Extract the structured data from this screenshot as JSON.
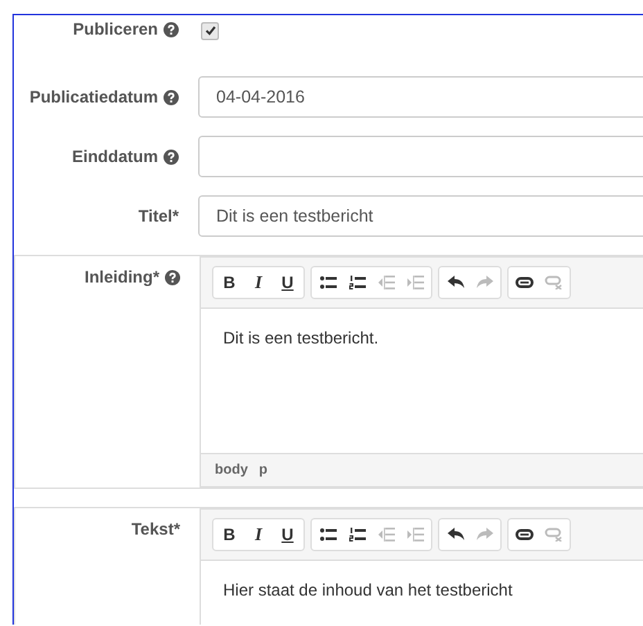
{
  "fields": [
    {
      "label": "Publiceren",
      "help": true,
      "kind": "checkbox",
      "checked": true
    },
    {
      "label": "Publicatiedatum",
      "help": true,
      "kind": "text",
      "value": "04-04-2016"
    },
    {
      "label": "Einddatum",
      "help": true,
      "kind": "text"
    },
    {
      "label": "Titel*",
      "help": false,
      "kind": "text",
      "value": "Dit is een testbericht"
    },
    {
      "label": "Inleiding*",
      "help": true,
      "kind": "editor",
      "content": "Dit is een testbericht.",
      "path": [
        "body",
        "p"
      ],
      "toolbar": [
        [
          {
            "kind": "bold",
            "label": "B",
            "disabled": false
          },
          {
            "kind": "italic",
            "label": "I",
            "disabled": false
          },
          {
            "kind": "underline",
            "label": "U",
            "disabled": false
          }
        ],
        [
          {
            "kind": "bullets",
            "disabled": false
          },
          {
            "kind": "numbers",
            "disabled": false
          },
          {
            "kind": "outdent",
            "disabled": true
          },
          {
            "kind": "indent",
            "disabled": true
          }
        ],
        [
          {
            "kind": "undo",
            "disabled": false
          },
          {
            "kind": "redo",
            "disabled": true
          }
        ],
        [
          {
            "kind": "link",
            "disabled": false
          },
          {
            "kind": "unlink",
            "disabled": true
          }
        ]
      ]
    },
    {
      "label": "Tekst*",
      "help": false,
      "kind": "editor",
      "content": "Hier staat de inhoud van het testbericht",
      "toolbar": [
        [
          {
            "kind": "bold",
            "label": "B",
            "disabled": false
          },
          {
            "kind": "italic",
            "label": "I",
            "disabled": false
          },
          {
            "kind": "underline",
            "label": "U",
            "disabled": false
          }
        ],
        [
          {
            "kind": "bullets",
            "disabled": false
          },
          {
            "kind": "numbers",
            "disabled": false
          },
          {
            "kind": "outdent",
            "disabled": true
          },
          {
            "kind": "indent",
            "disabled": true
          }
        ],
        [
          {
            "kind": "undo",
            "disabled": false
          },
          {
            "kind": "redo",
            "disabled": true
          }
        ],
        [
          {
            "kind": "link",
            "disabled": false
          },
          {
            "kind": "unlink",
            "disabled": true
          }
        ]
      ]
    }
  ]
}
